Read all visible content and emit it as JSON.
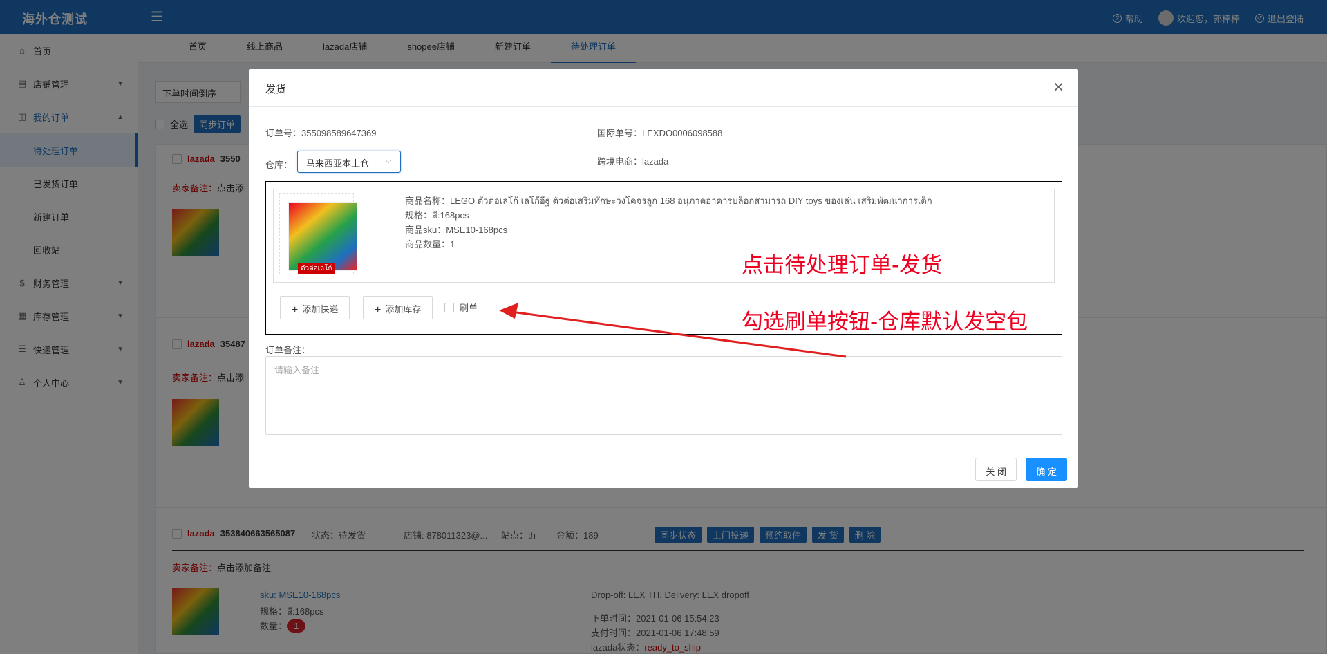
{
  "app": {
    "title": "海外仓测试"
  },
  "header": {
    "help": "帮助",
    "welcome": "欢迎您，郭棒棒",
    "logout": "退出登陆"
  },
  "sidebar": {
    "items": [
      {
        "label": "首页",
        "icon": "home-icon"
      },
      {
        "label": "店铺管理",
        "icon": "store-icon"
      },
      {
        "label": "我的订单",
        "icon": "bag-icon"
      },
      {
        "label": "财务管理",
        "icon": "money-icon"
      },
      {
        "label": "库存管理",
        "icon": "grid-icon"
      },
      {
        "label": "快递管理",
        "icon": "list-icon"
      },
      {
        "label": "个人中心",
        "icon": "user-icon"
      }
    ],
    "sub": [
      "待处理订单",
      "已发货订单",
      "新建订单",
      "回收站"
    ]
  },
  "tabs": [
    "首页",
    "线上商品",
    "lazada店铺",
    "shopee店铺",
    "新建订单",
    "待处理订单"
  ],
  "background": {
    "sort": "下单时间倒序",
    "select_all": "全选",
    "sync": "同步订单",
    "orders": [
      {
        "platform": "lazada",
        "id": "3550"
      },
      {
        "platform": "lazada",
        "id": "35487"
      },
      {
        "platform": "lazada",
        "id": "353840663565087",
        "status_label": "状态：",
        "status": "待发货",
        "shop": "店铺: 878011323@...",
        "site": "站点：th",
        "amount": "金额：189"
      }
    ],
    "remark_key": "卖家备注：",
    "remark_val": "点击添加备注",
    "remark_val_short": "点击添",
    "order_buttons": [
      "同步状态",
      "上门投递",
      "预约取件",
      "发 货",
      "删 除"
    ],
    "item": {
      "sku": "sku: MSE10-168pcs",
      "spec": "规格：สี:168pcs",
      "qty_label": "数量：",
      "qty": "1"
    },
    "delivery": "Drop-off: LEX TH, Delivery: LEX dropoff",
    "order_time": "下单时间：2021-01-06 15:54:23",
    "pay_time": "支付时间：2021-01-06 17:48:59",
    "lazada_status_label": "lazada状态：",
    "lazada_status": "ready_to_ship"
  },
  "dialog": {
    "title": "发货",
    "order_no": "订单号：355098589647369",
    "intl_no": "国际单号：LEXDO0006098588",
    "warehouse_label": "仓库：",
    "warehouse": "马来西亚本土仓",
    "platform": "跨境电商：lazada",
    "product": {
      "name": "商品名称：LEGO ตัวต่อเลโก้ เลโก้อีฐ ตัวต่อเสริมทักษะวงโคจรลูก 168 อนุภาคอาคารบล็อกสามารถ DIY toys ของเล่น เสริมพัฒนาการเด็ก",
      "spec": "规格：สี:168pcs",
      "sku": "商品sku：MSE10-168pcs",
      "qty": "商品数量：1",
      "img_caption": "ตัวต่อเลโก้"
    },
    "add_express": "添加快递",
    "add_stock": "添加库存",
    "brush": "刷单",
    "remark_label": "订单备注：",
    "remark_placeholder": "请输入备注",
    "close": "关 闭",
    "ok": "确 定"
  },
  "annotations": {
    "a1": "点击待处理订单-发货",
    "a2": "勾选刷单按钮-仓库默认发空包",
    "color": "#e02020"
  }
}
